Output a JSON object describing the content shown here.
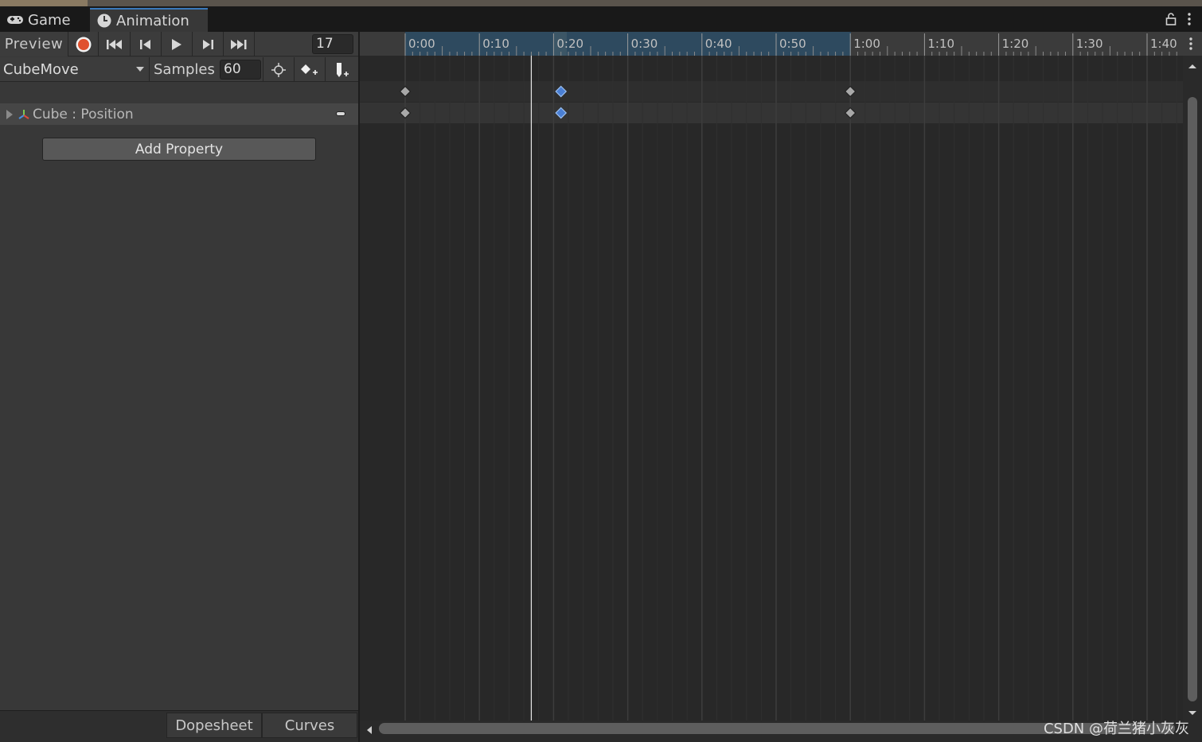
{
  "tabs": [
    {
      "label": "Game",
      "icon": "gamepad-icon"
    },
    {
      "label": "Animation",
      "icon": "clock-icon"
    }
  ],
  "toolbar": {
    "preview_label": "Preview",
    "frame_value": "17",
    "clip_name": "CubeMove",
    "samples_label": "Samples",
    "samples_value": "60"
  },
  "property": {
    "label": "Cube : Position"
  },
  "add_property_label": "Add Property",
  "bottom_tabs": {
    "dopesheet": "Dopesheet",
    "curves": "Curves"
  },
  "ruler": {
    "labels": [
      "0:00",
      "0:10",
      "0:20",
      "0:30",
      "0:40",
      "0:50",
      "1:00",
      "1:10",
      "1:20",
      "1:30",
      "1:40"
    ]
  },
  "keyframes": {
    "rows": [
      "summary",
      "Cube : Position"
    ],
    "frames": [
      0,
      21,
      60
    ],
    "selected_frame": 21
  },
  "playhead_frame": 17,
  "watermark": "CSDN @荷兰猪小灰灰",
  "colors": {
    "accent": "#3a79bb",
    "record": "#e0512e",
    "range": "#2e4a5f",
    "selected_key": "#4a7fd4"
  }
}
